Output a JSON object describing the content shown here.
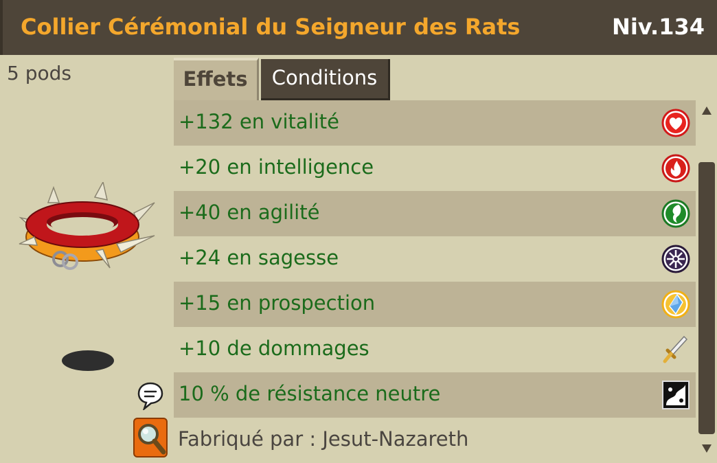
{
  "item": {
    "name": "Collier Cérémonial du Seigneur des Rats",
    "level": "Niv.134",
    "weight": "5 pods"
  },
  "tabs": {
    "effects": "Effets",
    "conditions": "Conditions",
    "active": "effects"
  },
  "effects": [
    {
      "text": "+132 en vitalité",
      "icon": "heart-icon"
    },
    {
      "text": "+20 en intelligence",
      "icon": "fire-icon"
    },
    {
      "text": "+40 en agilité",
      "icon": "wind-icon"
    },
    {
      "text": "+24 en sagesse",
      "icon": "wisdom-icon"
    },
    {
      "text": "+15 en prospection",
      "icon": "crystal-icon"
    },
    {
      "text": "+10 de dommages",
      "icon": "sword-icon"
    },
    {
      "text": "10 % de résistance neutre",
      "icon": "neutral-icon"
    }
  ],
  "crafter": "Fabriqué par : Jesut-Nazareth",
  "colors": {
    "title_bar": "#4e4539",
    "item_name": "#f4a72c",
    "effect_text": "#1b6b1b",
    "row_dark": "#bdb396",
    "row_light": "#d6d1b1"
  }
}
